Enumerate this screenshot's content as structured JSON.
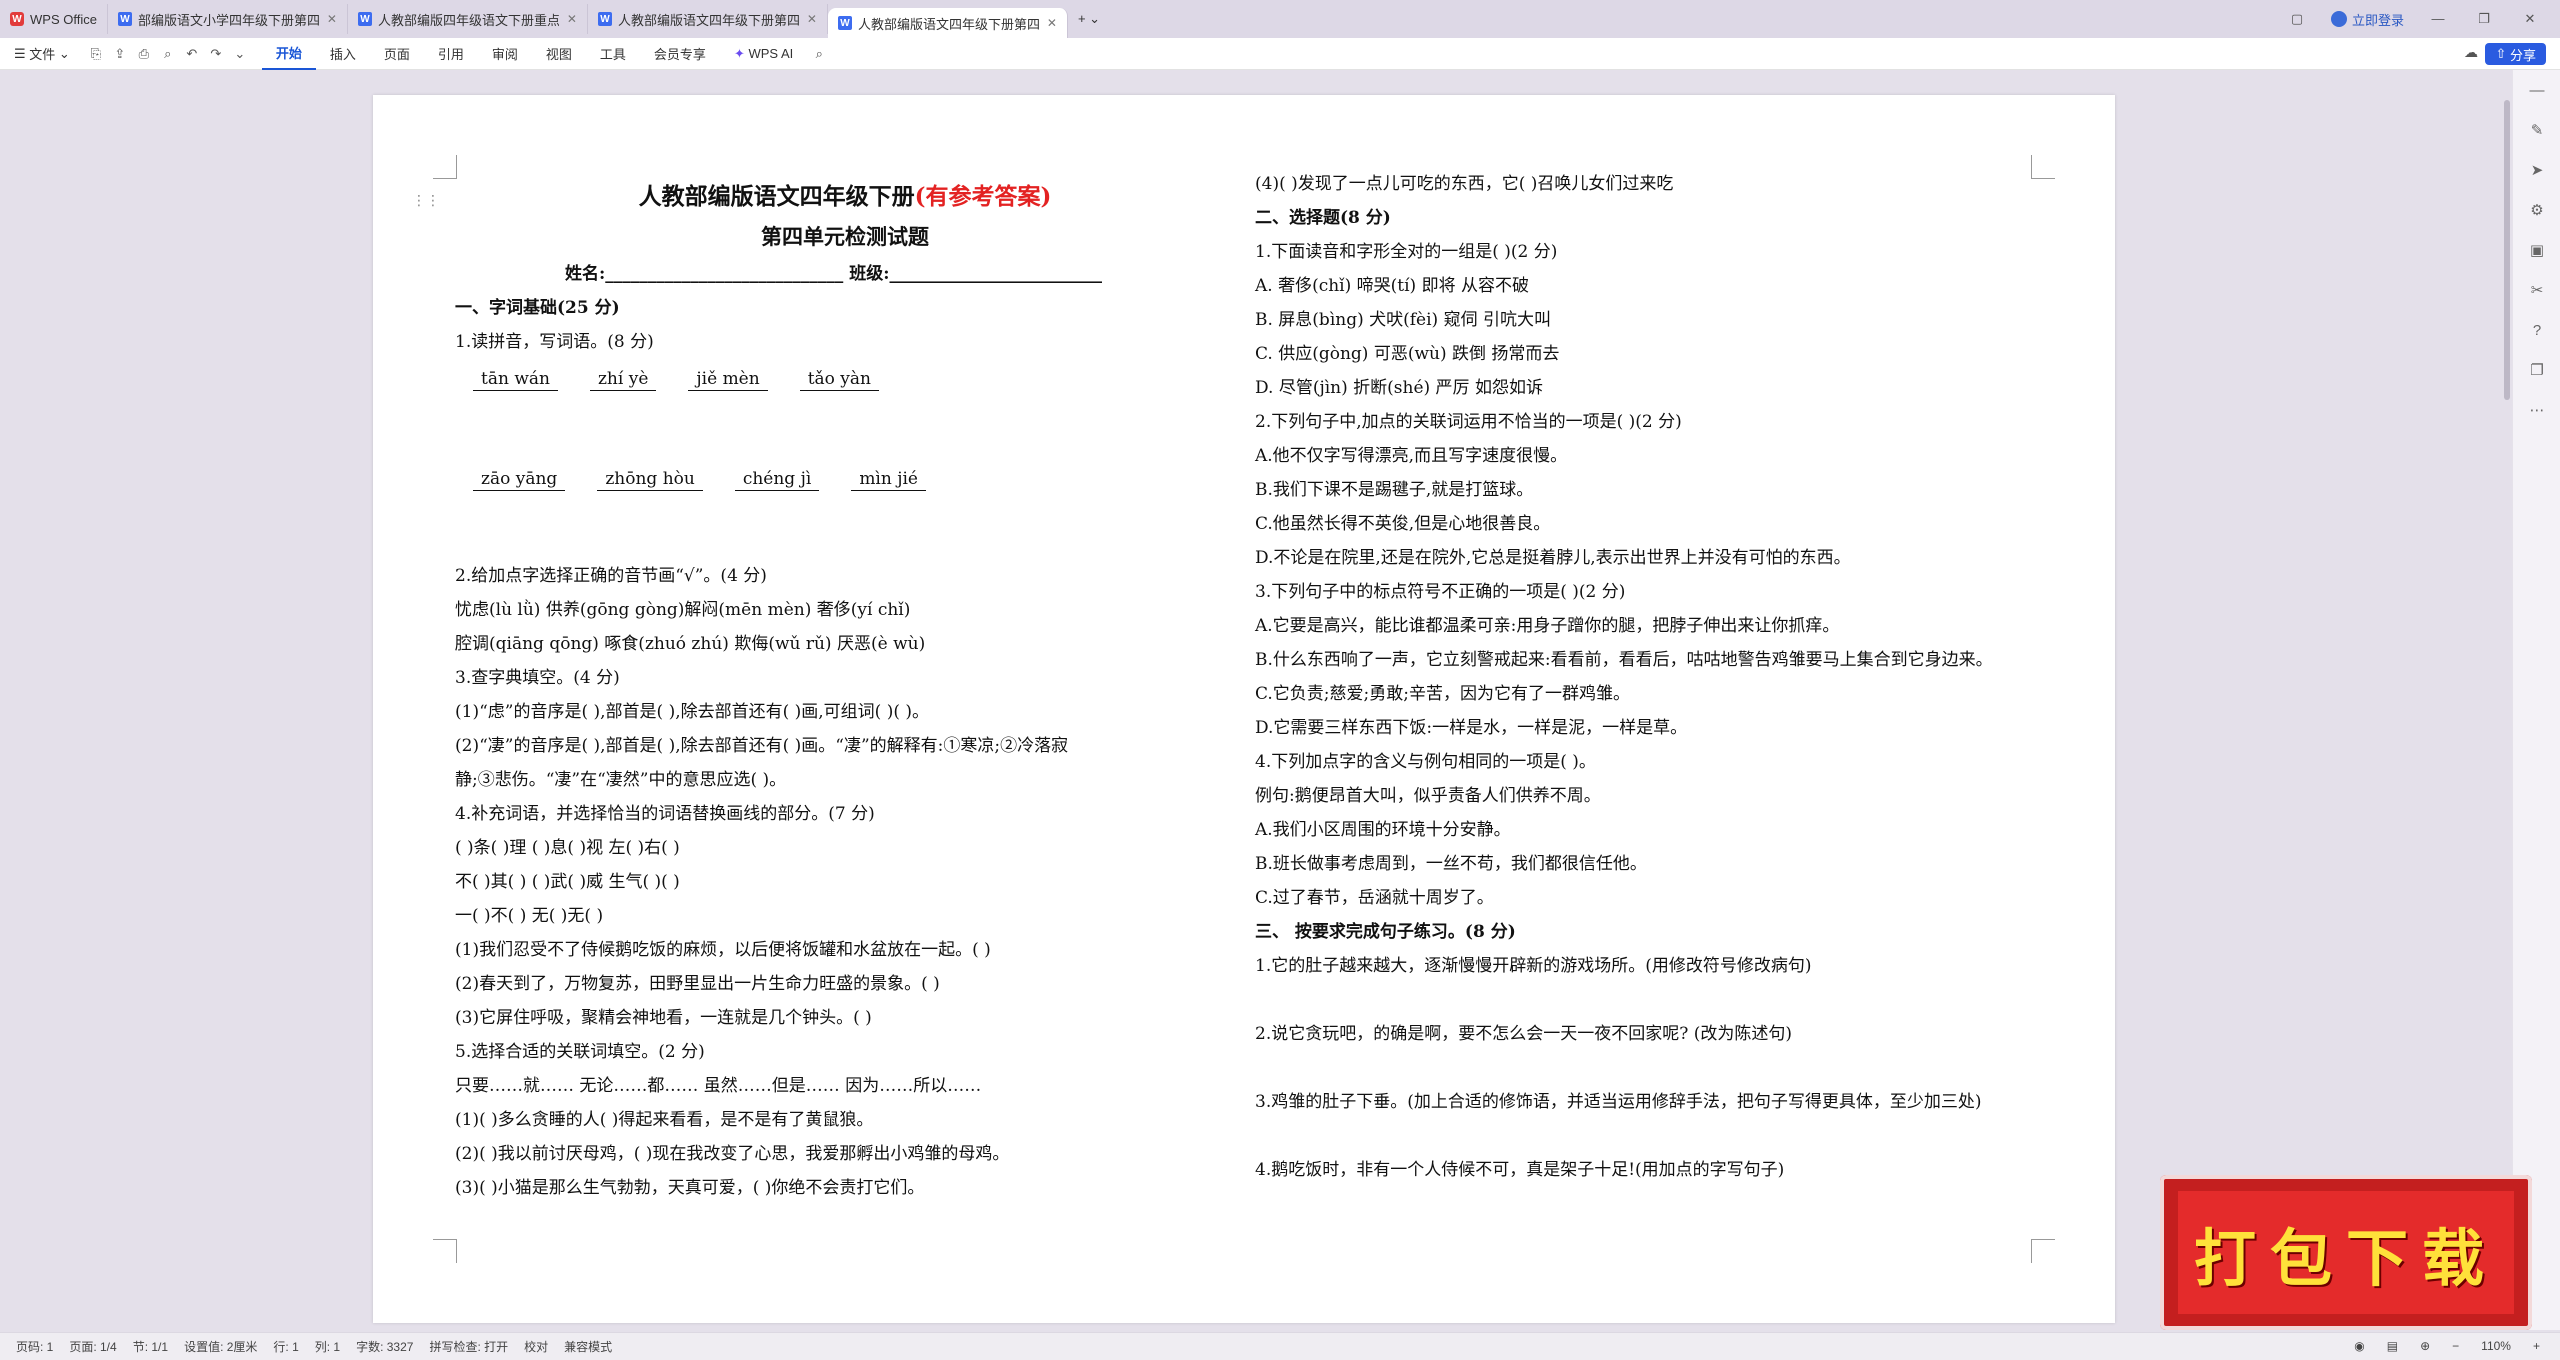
{
  "tabs": [
    {
      "label": "WPS Office",
      "kind": "wps"
    },
    {
      "label": "部编版语文小学四年级下册第四单元",
      "kind": "w"
    },
    {
      "label": "人教部编版四年级语文下册重点学校",
      "kind": "w"
    },
    {
      "label": "人教部编版语文四年级下册第四单元",
      "kind": "w"
    },
    {
      "label": "人教部编版语文四年级下册第四",
      "kind": "w"
    }
  ],
  "tab_right": {
    "login": "立即登录"
  },
  "ribbon": {
    "file": "文件",
    "items": [
      "开始",
      "插入",
      "页面",
      "引用",
      "审阅",
      "视图",
      "工具",
      "会员专享"
    ],
    "ai": "WPS AI",
    "share": "分享"
  },
  "doc": {
    "left": {
      "title_black": "人教部编版语文四年级下册",
      "title_red": "(有参考答案)",
      "subtitle": "第四单元检测试题",
      "name_line": "姓名:____________________________   班级:_________________________",
      "lines": [
        {
          "t": "一、字词基础(25 分)",
          "b": true
        },
        {
          "t": "1.读拼音，写词语。(8 分)"
        }
      ],
      "pinyin1": [
        "tān wán",
        "zhí yè",
        "jiě mèn",
        "tǎo yàn"
      ],
      "pinyin2": [
        "zāo yāng",
        "zhōng hòu",
        "chéng jì",
        "mìn jié"
      ],
      "lines2": [
        "2.给加点字选择正确的音节画“√”。(4 分)",
        "忧虑(lù lǜ) 供养(gōng gòng)解闷(mēn mèn)   奢侈(yí chǐ)",
        "腔调(qiāng qōng)  啄食(zhuó zhú) 欺侮(wǔ rǔ)     厌恶(è wù)",
        "3.查字典填空。(4 分)",
        "(1)“虑”的音序是(  ),部首是(  ),除去部首还有(  )画,可组词(        )(        )。",
        "(2)“凄”的音序是(     ),部首是(     ),除去部首还有(     )画。“凄”的解释有:①寒凉;②冷落寂",
        "静;③悲伤。“凄”在“凄然”中的意思应选(     )。",
        "4.补充词语，并选择恰当的词语替换画线的部分。(7 分)",
        "(     )条(     )理          (     )息(     )视   左(     )右(     )",
        "不(     )其(     )          (     )武(     )威    生气(     )(     )",
        "一(     )不(     )          无(     )无(     )",
        "(1)我们忍受不了侍候鹅吃饭的麻烦，以后便将饭罐和水盆放在一起。(          )",
        "(2)春天到了，万物复苏，田野里显出一片生命力旺盛的景象。(            )",
        "(3)它屏住呼吸，聚精会神地看，一连就是几个钟头。(            )",
        "5.选择合适的关联词填空。(2 分)",
        "    只要……就……    无论……都……    虽然……但是……     因为……所以……",
        " (1)(     )多么贪睡的人(     )得起来看看，是不是有了黄鼠狼。",
        " (2)(     )我以前讨厌母鸡，(     )现在我改变了心思，我爱那孵出小鸡雏的母鸡。",
        " (3)(     )小猫是那么生气勃勃，天真可爱，(     )你绝不会责打它们。"
      ]
    },
    "right": {
      "lines": [
        {
          "t": "(4)(     )发现了一点儿可吃的东西，它(     )召唤儿女们过来吃"
        },
        {
          "t": "二、选择题(8 分)",
          "b": true
        },
        {
          "t": "1.下面读音和字形全对的一组是(      )(2 分)"
        },
        {
          "t": "A. 奢侈(chǐ)        啼哭(tí)      即将          从容不破"
        },
        {
          "t": "B. 屏息(bìng)          犬吠(fèi)        窥伺          引吭大叫"
        },
        {
          "t": "C. 供应(gòng)          可恶(wù)          跌倒          扬常而去"
        },
        {
          "t": "D. 尽管(jìn)          折断(shé)         严厉          如怨如诉"
        },
        {
          "t": "2.下列句子中,加点的关联词运用不恰当的一项是(      )(2 分)"
        },
        {
          "t": "A.他不仅字写得漂亮,而且写字速度很慢。"
        },
        {
          "t": "B.我们下课不是踢毽子,就是打篮球。"
        },
        {
          "t": "C.他虽然长得不英俊,但是心地很善良。"
        },
        {
          "t": "D.不论是在院里,还是在院外,它总是挺着脖儿,表示出世界上并没有可怕的东西。"
        },
        {
          "t": "3.下列句子中的标点符号不正确的一项是(      )(2 分)"
        },
        {
          "t": "A.它要是高兴，能比谁都温柔可亲:用身子蹭你的腿，把脖子伸出来让你抓痒。"
        },
        {
          "t": "B.什么东西响了一声，它立刻警戒起来:看看前，看看后，咕咕地警告鸡雏要马上集合到它身边来。"
        },
        {
          "t": "C.它负责;慈爱;勇敢;辛苦，因为它有了一群鸡雏。"
        },
        {
          "t": "D.它需要三样东西下饭:一样是水，一样是泥，一样是草。"
        },
        {
          "t": "4.下列加点字的含义与例句相同的一项是(      )。"
        },
        {
          "t": "   例句:鹅便昂首大叫，似乎责备人们供养不周。"
        },
        {
          "t": "A.我们小区周围的环境十分安静。"
        },
        {
          "t": "B.班长做事考虑周到，一丝不苟，我们都很信任他。"
        },
        {
          "t": "C.过了春节，岳涵就十周岁了。"
        },
        {
          "t": "三、  按要求完成句子练习。(8 分)",
          "b": true
        },
        {
          "t": "1.它的肚子越来越大，逐渐慢慢开辟新的游戏场所。(用修改符号修改病句)"
        },
        {
          "t": ""
        },
        {
          "t": "2.说它贪玩吧，的确是啊，要不怎么会一天一夜不回家呢? (改为陈述句)"
        },
        {
          "t": ""
        },
        {
          "t": "3.鸡雏的肚子下垂。(加上合适的修饰语，并适当运用修辞手法，把句子写得更具体，至少加三处)"
        },
        {
          "t": ""
        },
        {
          "t": "4.鹅吃饭时，非有一个人侍候不可，真是架子十足!(用加点的字写句子)"
        }
      ]
    }
  },
  "status": {
    "items": [
      "页码: 1",
      "页面: 1/4",
      "节: 1/1",
      "设置值: 2厘米",
      "行: 1",
      "列: 1",
      "字数: 3327",
      "拼写检查: 打开",
      "校对",
      "兼容模式"
    ],
    "zoom": "110%"
  },
  "download_banner": "打包下载"
}
